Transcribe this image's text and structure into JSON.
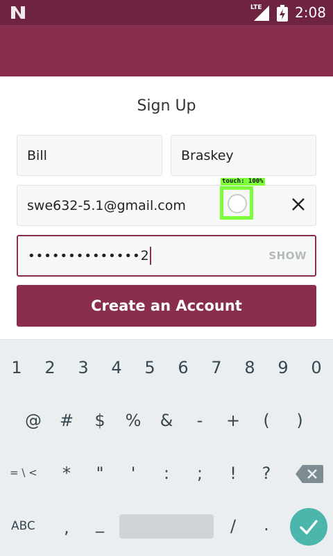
{
  "status_bar": {
    "network": "LTE",
    "time": "2:08",
    "icons": [
      "n-logo-icon",
      "signal-icon",
      "battery-charging-icon"
    ]
  },
  "form": {
    "title": "Sign Up",
    "first_name": "Bill",
    "last_name": "Braskey",
    "email": "swe632-5.1@gmail.com",
    "password_masked": "••••••••••••••",
    "password_last_char": "2",
    "show_label": "SHOW",
    "submit_label": "Create an Account"
  },
  "touch_overlay": {
    "label": "touch: 100%"
  },
  "keyboard": {
    "row1": [
      "1",
      "2",
      "3",
      "4",
      "5",
      "6",
      "7",
      "8",
      "9",
      "0"
    ],
    "row2": [
      "@",
      "#",
      "$",
      "%",
      "&",
      "-",
      "+",
      "(",
      ")"
    ],
    "row3": [
      "*",
      "\"",
      "'",
      ":",
      ";",
      "!",
      "?"
    ],
    "alt_symbols_label": "= \\ <",
    "abc_label": "ABC",
    "row4": [
      ",",
      "_",
      "/",
      "."
    ],
    "colors": {
      "accent": "#8a2e4f",
      "done": "#4db6ac"
    }
  }
}
